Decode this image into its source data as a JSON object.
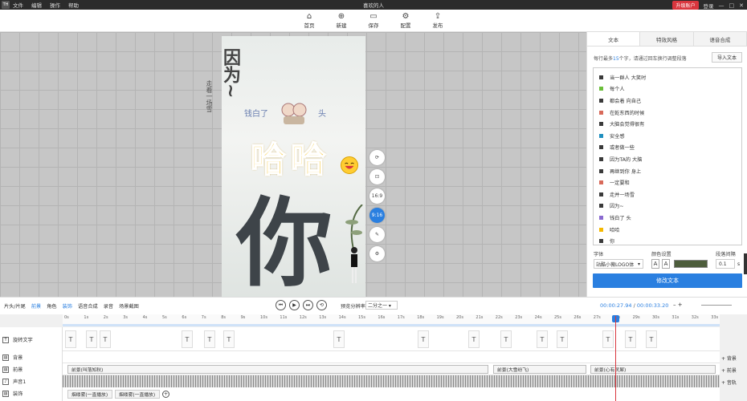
{
  "titlebar": {
    "logo": "TH",
    "menus": [
      "文件",
      "编辑",
      "操作",
      "帮助"
    ],
    "title": "喜欢的人",
    "vip": "升级账户",
    "login": "登录"
  },
  "toolbar": {
    "items": [
      {
        "label": "首页",
        "icon": "home-icon"
      },
      {
        "label": "新建",
        "icon": "new-icon"
      },
      {
        "label": "保存",
        "icon": "save-icon"
      },
      {
        "label": "配置",
        "icon": "gear-icon"
      },
      {
        "label": "发布",
        "icon": "publish-icon"
      }
    ]
  },
  "canvas": {
    "vertical_text": "因为~",
    "side_text": "走着一场雪",
    "hua_left": "钱白了",
    "hua_right": "头",
    "haha": "哈哈",
    "ni": "你",
    "sidetools": [
      {
        "label": "⟳",
        "icon": "rotate-icon"
      },
      {
        "label": "⊡",
        "icon": "lock-icon"
      },
      {
        "label": "16:9",
        "icon": "ratio-16-9"
      },
      {
        "label": "9:16",
        "icon": "ratio-9-16"
      },
      {
        "label": "✎",
        "icon": "edit-icon"
      },
      {
        "label": "⚙",
        "icon": "settings-icon"
      }
    ]
  },
  "rpanel": {
    "tabs": [
      "文本",
      "特效风格",
      "语音合成"
    ],
    "hint_prefix": "每行最多",
    "hint_num": "15",
    "hint_suffix": "个字，请通过回车换行调整段落",
    "import": "导入文本",
    "items": [
      {
        "text": "当一群人      大笑时",
        "color": "#3a3a3a"
      },
      {
        "text": "每个人",
        "color": "#6bbf3a"
      },
      {
        "text": "都会着      向自己",
        "color": "#3a3a3a"
      },
      {
        "text": "在乾东西的时候",
        "color": "#d86a5a"
      },
      {
        "text": "大脑会觉得很有",
        "color": "#3a3a3a"
      },
      {
        "text": "安全感",
        "color": "#1f8fbf"
      },
      {
        "text": "或者做一些",
        "color": "#3a3a3a"
      },
      {
        "text": "因为TA的        大脑",
        "color": "#3a3a3a"
      },
      {
        "text": "再继到你        身上",
        "color": "#3a3a3a"
      },
      {
        "text": "一定要和",
        "color": "#d86a5a"
      },
      {
        "text": "走并一场雪",
        "color": "#3a3a3a"
      },
      {
        "text": "因为~",
        "color": "#3a3a3a"
      },
      {
        "text": "钱白了          头",
        "color": "#8a6ad0"
      },
      {
        "text": "哈哈",
        "color": "#f5b800"
      },
      {
        "text": "你",
        "color": "#3a3a3a"
      }
    ],
    "font_label": "字体",
    "color_label": "颜色设置",
    "spacing_label": "段落间隔",
    "font_value": "站酷小薇LOGO体",
    "color_value": "#4d5d3c",
    "spacing_value": "0.1",
    "spacing_unit": "s",
    "modify": "修改文本"
  },
  "tlbar": {
    "tools": [
      "片头/片尾",
      "前景",
      "角色",
      "装饰",
      "语音合成",
      "录音",
      "场景截图"
    ],
    "selected": [
      "前景",
      "装饰"
    ],
    "res_label": "预览分辨率",
    "res_value": "二分之一",
    "time_current": "00:00:27.94",
    "time_sep": " / ",
    "time_total": "00:00:33.20"
  },
  "ruler": [
    "0s",
    "1s",
    "2s",
    "3s",
    "4s",
    "5s",
    "6s",
    "7s",
    "8s",
    "9s",
    "10s",
    "11s",
    "12s",
    "13s",
    "14s",
    "15s",
    "16s",
    "17s",
    "18s",
    "19s",
    "20s",
    "21s",
    "22s",
    "23s",
    "24s",
    "25s",
    "26s",
    "27s",
    "28s",
    "29s",
    "30s",
    "31s",
    "32s",
    "33s"
  ],
  "tracks": {
    "labels": [
      "旋转文字",
      "背景",
      "前景",
      "声音1",
      "装饰"
    ],
    "fg_clips": [
      "前景(叫落知秋)",
      "前景(大雪纷飞)",
      "前景(心有灵犀)"
    ],
    "fx_clips": [
      "烟缕雾(一直播放)",
      "烟缕雾(一直播放)"
    ],
    "add_labels": [
      "+ 背景",
      "+ 前景",
      "+ 音轨"
    ]
  }
}
